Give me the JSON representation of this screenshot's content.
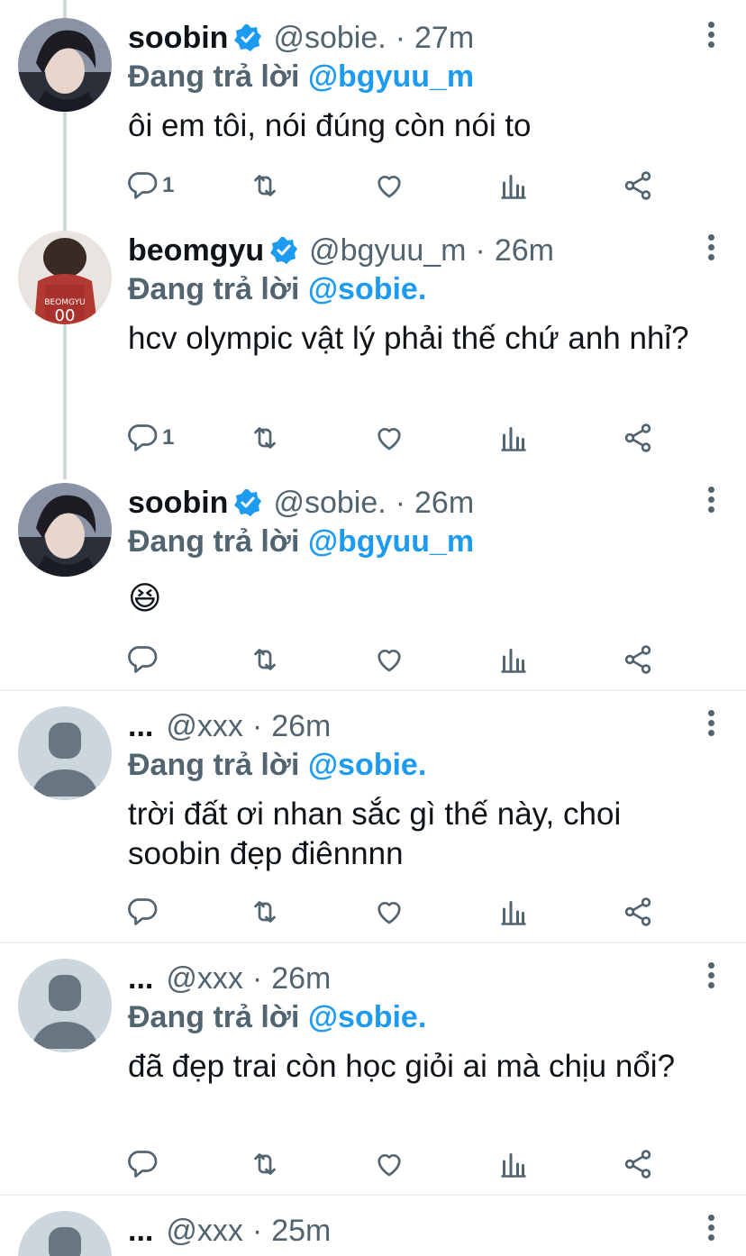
{
  "tweets": [
    {
      "name": "soobin",
      "verified": true,
      "handle": "@sobie.",
      "time": "27m",
      "replying_prefix": "Đang trả lời",
      "replying_to": "@bgyuu_m",
      "text": "ôi em tôi, nói đúng còn nói to",
      "reply_count": "1",
      "avatar": "photo-dark-hair"
    },
    {
      "name": "beomgyu",
      "verified": true,
      "handle": "@bgyuu_m",
      "time": "26m",
      "replying_prefix": "Đang trả lời",
      "replying_to": "@sobie.",
      "text": "hcv olympic vật lý phải thế chứ anh nhỉ?",
      "reply_count": "1",
      "avatar": "photo-red-jersey"
    },
    {
      "name": "soobin",
      "verified": true,
      "handle": "@sobie.",
      "time": "26m",
      "replying_prefix": "Đang trả lời",
      "replying_to": "@bgyuu_m",
      "text": "😆",
      "reply_count": "",
      "avatar": "photo-dark-hair"
    },
    {
      "name": "...",
      "verified": false,
      "handle": "@xxx",
      "time": "26m",
      "replying_prefix": "Đang trả lời",
      "replying_to": "@sobie.",
      "text": "trời đất ơi nhan sắc gì thế này, choi soobin đẹp điênnnn",
      "reply_count": "",
      "avatar": "default-avatar"
    },
    {
      "name": "...",
      "verified": false,
      "handle": "@xxx",
      "time": "26m",
      "replying_prefix": "Đang trả lời",
      "replying_to": "@sobie.",
      "text": "đã đẹp trai còn học giỏi ai mà chịu nổi?",
      "reply_count": "",
      "avatar": "default-avatar"
    },
    {
      "name": "...",
      "verified": false,
      "handle": "@xxx",
      "time": "25m",
      "replying_prefix": "",
      "replying_to": "",
      "text": "",
      "reply_count": "",
      "avatar": "default-avatar"
    }
  ],
  "colors": {
    "accent": "#1d9bf0",
    "muted": "#536471",
    "text": "#0f1419",
    "thread_line": "#cfd9de",
    "default_avatar_bg": "#ccd6dd"
  },
  "icons": [
    "reply-icon",
    "retweet-icon",
    "like-icon",
    "analytics-icon",
    "share-icon",
    "more-icon",
    "verified-badge-icon"
  ]
}
